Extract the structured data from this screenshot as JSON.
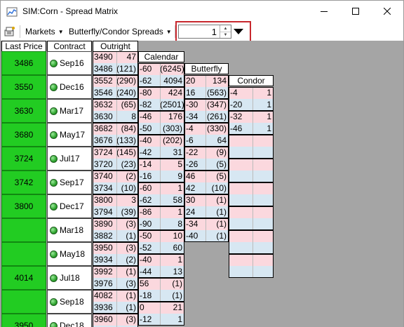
{
  "window": {
    "title": "SIM:Corn - Spread Matrix"
  },
  "toolbar": {
    "markets_label": "Markets",
    "strategy_label": "Butterfly/Condor Spreads",
    "quantity_value": "1"
  },
  "headers": {
    "last_price": "Last Price",
    "contract": "Contract",
    "outright": "Outright",
    "calendar": "Calendar",
    "butterfly": "Butterfly",
    "condor": "Condor"
  },
  "contracts": [
    {
      "name": "Sep16",
      "last": "3486"
    },
    {
      "name": "Dec16",
      "last": "3550"
    },
    {
      "name": "Mar17",
      "last": "3630"
    },
    {
      "name": "May17",
      "last": "3680"
    },
    {
      "name": "Jul17",
      "last": "3724"
    },
    {
      "name": "Sep17",
      "last": "3742"
    },
    {
      "name": "Dec17",
      "last": "3800"
    },
    {
      "name": "Mar18",
      "last": ""
    },
    {
      "name": "May18",
      "last": ""
    },
    {
      "name": "Jul18",
      "last": "4014"
    },
    {
      "name": "Sep18",
      "last": ""
    },
    {
      "name": "Dec18",
      "last": "3950"
    }
  ],
  "outright": [
    [
      [
        "3490",
        "47"
      ],
      [
        "3486",
        "(121)"
      ]
    ],
    [
      [
        "3552",
        "(290)"
      ],
      [
        "3546",
        "(240)"
      ]
    ],
    [
      [
        "3632",
        "(65)"
      ],
      [
        "3630",
        "8"
      ]
    ],
    [
      [
        "3682",
        "(84)"
      ],
      [
        "3676",
        "(133)"
      ]
    ],
    [
      [
        "3724",
        "(145)"
      ],
      [
        "3720",
        "(23)"
      ]
    ],
    [
      [
        "3740",
        "(2)"
      ],
      [
        "3734",
        "(10)"
      ]
    ],
    [
      [
        "3800",
        "3"
      ],
      [
        "3794",
        "(39)"
      ]
    ],
    [
      [
        "3890",
        "(3)"
      ],
      [
        "3882",
        "(1)"
      ]
    ],
    [
      [
        "3950",
        "(3)"
      ],
      [
        "3934",
        "(2)"
      ]
    ],
    [
      [
        "3992",
        "(1)"
      ],
      [
        "3976",
        "(3)"
      ]
    ],
    [
      [
        "4082",
        "(1)"
      ],
      [
        "3936",
        "(1)"
      ]
    ],
    [
      [
        "3960",
        "(3)"
      ],
      [
        "",
        ""
      ]
    ]
  ],
  "calendar": [
    [
      [
        "-60",
        "(6245)"
      ],
      [
        "-62",
        "4094"
      ]
    ],
    [
      [
        "-80",
        "424"
      ],
      [
        "-82",
        "(2501)"
      ]
    ],
    [
      [
        "-46",
        "176"
      ],
      [
        "-50",
        "(303)"
      ]
    ],
    [
      [
        "-40",
        "(202)"
      ],
      [
        "-42",
        "31"
      ]
    ],
    [
      [
        "-14",
        "5"
      ],
      [
        "-16",
        "9"
      ]
    ],
    [
      [
        "-60",
        "1"
      ],
      [
        "-62",
        "58"
      ]
    ],
    [
      [
        "-86",
        "1"
      ],
      [
        "-90",
        "8"
      ]
    ],
    [
      [
        "-50",
        "10"
      ],
      [
        "-52",
        "60"
      ]
    ],
    [
      [
        "-40",
        "1"
      ],
      [
        "-44",
        "13"
      ]
    ],
    [
      [
        "56",
        "(1)"
      ],
      [
        "-18",
        "(1)"
      ]
    ],
    [
      [
        "0",
        "21"
      ],
      [
        "-12",
        "1"
      ]
    ]
  ],
  "butterfly": [
    [
      [
        "20",
        "134"
      ],
      [
        "16",
        "(563)"
      ]
    ],
    [
      [
        "-30",
        "(347)"
      ],
      [
        "-34",
        "(261)"
      ]
    ],
    [
      [
        "-4",
        "(330)"
      ],
      [
        "-6",
        "64"
      ]
    ],
    [
      [
        "-22",
        "(9)"
      ],
      [
        "-26",
        "(5)"
      ]
    ],
    [
      [
        "46",
        "(5)"
      ],
      [
        "42",
        "(10)"
      ]
    ],
    [
      [
        "30",
        "(1)"
      ],
      [
        "24",
        "(1)"
      ]
    ],
    [
      [
        "-34",
        "(1)"
      ],
      [
        "-40",
        "(1)"
      ]
    ]
  ],
  "condor": [
    [
      [
        "-4",
        "1"
      ],
      [
        "-20",
        "1"
      ]
    ],
    [
      [
        "-32",
        "1"
      ],
      [
        "-46",
        "1"
      ]
    ],
    [
      [
        "",
        ""
      ],
      [
        "",
        ""
      ]
    ],
    [
      [
        "",
        ""
      ],
      [
        "",
        ""
      ]
    ],
    [
      [
        "",
        ""
      ],
      [
        "",
        ""
      ]
    ],
    [
      [
        "",
        ""
      ],
      [
        "",
        ""
      ]
    ],
    [
      [
        "",
        ""
      ],
      [
        "",
        ""
      ]
    ],
    [
      [
        "",
        ""
      ],
      [
        "",
        ""
      ]
    ]
  ]
}
